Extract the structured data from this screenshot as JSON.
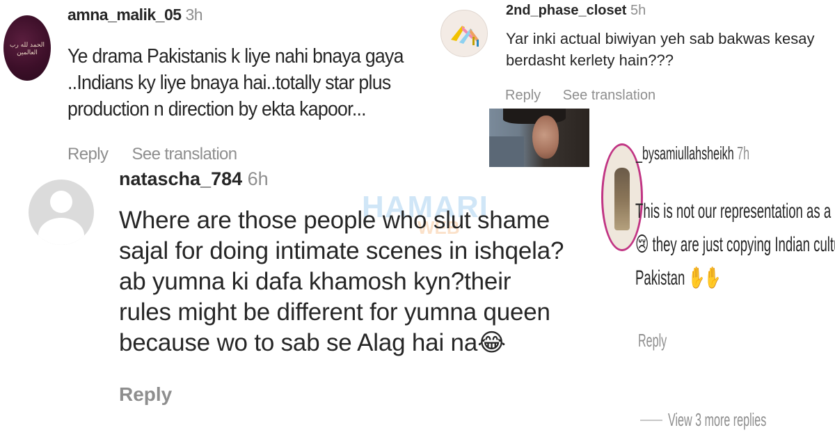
{
  "comments": [
    {
      "username": "amna_malik_05",
      "time": "3h",
      "avatar_text": "الحمد لله رب العالمين",
      "text": "Ye drama Pakistanis k liye nahi bnaya gaya ..Indians ky liye bnaya hai..totally star plus production n direction by ekta kapoor...",
      "reply_label": "Reply",
      "translate_label": "See translation"
    },
    {
      "username": "2nd_phase_closet",
      "time": "5h",
      "text": "Yar inki actual biwiyan yeh sab bakwas kesay berdasht kerlety hain???",
      "reply_label": "Reply",
      "translate_label": "See translation"
    },
    {
      "username": "natascha_784",
      "time": "6h",
      "text_lines": [
        "Where are those people who slut shame",
        "sajal for doing intimate scenes in ishqela?",
        "ab yumna ki dafa khamosh kyn?their",
        "rules might be different for yumna queen",
        "because wo to sab se Alag hai na😂"
      ],
      "reply_label": "Reply"
    },
    {
      "username": "_bysamiullahsheikh",
      "time": "7h",
      "text_lines": [
        "This is not our representation as a Muslim",
        "😢 they are just copying Indian culture in",
        "Pakistan ✋✋"
      ],
      "reply_label": "Reply",
      "more_replies": "View 3 more replies"
    }
  ],
  "watermark": {
    "main": "HAMARI",
    "sub": "WEB"
  },
  "colors": {
    "text": "#262626",
    "muted": "#8e8e8e",
    "story_ring": "#c13584",
    "watermark_blue": "#5aa7e6"
  }
}
